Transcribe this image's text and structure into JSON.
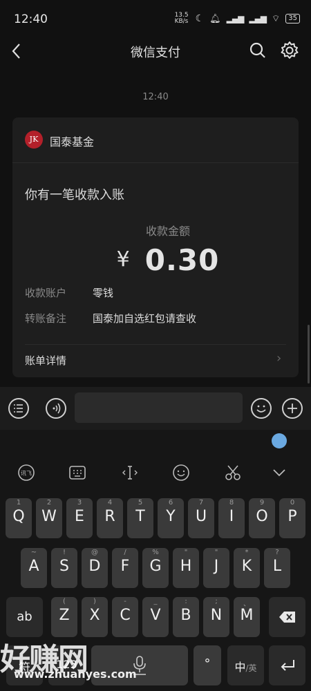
{
  "status": {
    "time": "12:40",
    "net_speed": "13.5 KB/s",
    "battery": "35"
  },
  "nav": {
    "title": "微信支付"
  },
  "chat": {
    "timestamp": "12:40",
    "card": {
      "brand_name": "国泰基金",
      "brand_logo_text": "JK",
      "headline": "你有一笔收款入账",
      "amount_label": "收款金额",
      "currency": "¥",
      "amount": "0.30",
      "rows": [
        {
          "key": "收款账户",
          "value": "零钱"
        },
        {
          "key": "转账备注",
          "value": "国泰加自选红包请查收"
        }
      ],
      "detail_link": "账单详情",
      "accent_color": "#b3202a"
    }
  },
  "keyboard": {
    "row1": [
      {
        "k": "Q",
        "s": "1"
      },
      {
        "k": "W",
        "s": "2"
      },
      {
        "k": "E",
        "s": "3"
      },
      {
        "k": "R",
        "s": "4"
      },
      {
        "k": "T",
        "s": "5"
      },
      {
        "k": "Y",
        "s": "6"
      },
      {
        "k": "U",
        "s": "7"
      },
      {
        "k": "I",
        "s": "8"
      },
      {
        "k": "O",
        "s": "9"
      },
      {
        "k": "P",
        "s": "0"
      }
    ],
    "row2": [
      {
        "k": "A",
        "s": "~"
      },
      {
        "k": "S",
        "s": "!"
      },
      {
        "k": "D",
        "s": "@"
      },
      {
        "k": "F",
        "s": "/"
      },
      {
        "k": "G",
        "s": "%"
      },
      {
        "k": "H",
        "s": "\""
      },
      {
        "k": "J",
        "s": "\""
      },
      {
        "k": "K",
        "s": "*"
      },
      {
        "k": "L",
        "s": "?"
      }
    ],
    "row3": [
      {
        "k": "Z",
        "s": "("
      },
      {
        "k": "X",
        "s": ")"
      },
      {
        "k": "C",
        "s": "-"
      },
      {
        "k": "V",
        "s": "_"
      },
      {
        "k": "B",
        "s": ":"
      },
      {
        "k": "N",
        "s": ";"
      },
      {
        "k": "M",
        "s": "、"
      }
    ],
    "shift_label": "ab",
    "bottom": {
      "sym": "符",
      "num": "123",
      "dot": "°",
      "lang_main": "中",
      "lang_sub": "/英"
    }
  },
  "watermark": {
    "brand": "好赚网",
    "url": "www.zhuanyes.com"
  }
}
